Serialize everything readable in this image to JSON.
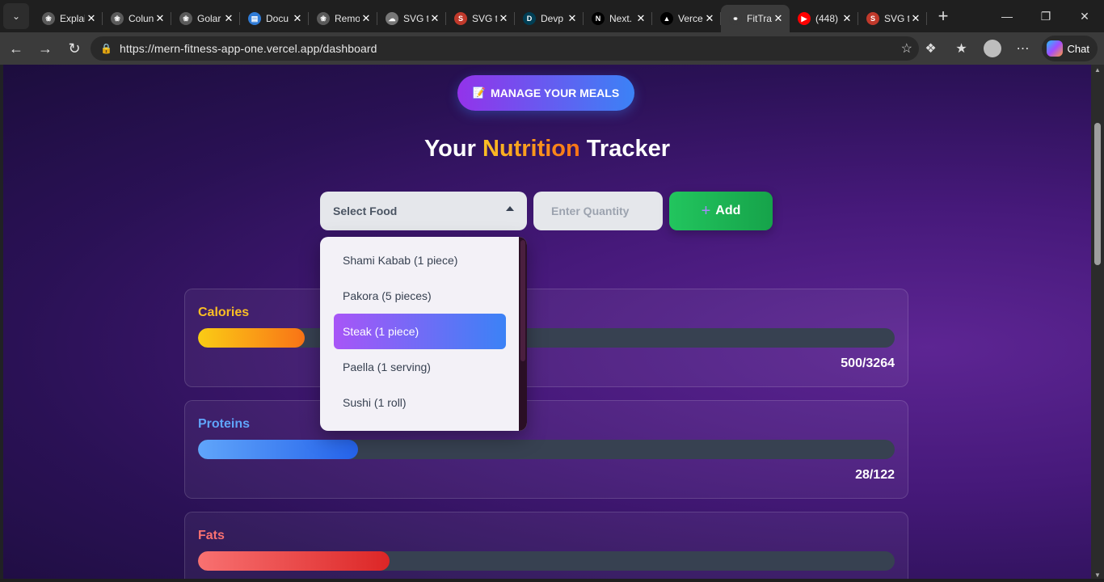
{
  "browser": {
    "tabs": [
      {
        "label": "Explai",
        "icon": "chatgpt-icon",
        "icon_color": "#5a5a5a",
        "active": false
      },
      {
        "label": "Colun",
        "icon": "chatgpt-icon",
        "icon_color": "#5a5a5a",
        "active": false
      },
      {
        "label": "Golar",
        "icon": "chatgpt-icon",
        "icon_color": "#5a5a5a",
        "active": false
      },
      {
        "label": "Docu",
        "icon": "doc-icon",
        "icon_color": "#2f7bd6",
        "active": false
      },
      {
        "label": "Remo",
        "icon": "chatgpt-icon",
        "icon_color": "#5a5a5a",
        "active": false
      },
      {
        "label": "SVG t",
        "icon": "cloud-icon",
        "icon_color": "#777777",
        "active": false
      },
      {
        "label": "SVG t",
        "icon": "svg-jpg-icon",
        "icon_color": "#c0392b",
        "active": false
      },
      {
        "label": "Devp",
        "icon": "devpost-icon",
        "icon_color": "#003e54",
        "active": false
      },
      {
        "label": "Next.",
        "icon": "nextjs-icon",
        "icon_color": "#000000",
        "active": false
      },
      {
        "label": "Verce",
        "icon": "vercel-icon",
        "icon_color": "#000000",
        "active": false
      },
      {
        "label": "FitTra",
        "icon": "link-icon",
        "icon_color": "#3b3b3b",
        "active": true
      },
      {
        "label": "(448)",
        "icon": "youtube-icon",
        "icon_color": "#ff0000",
        "active": false
      },
      {
        "label": "SVG t",
        "icon": "svg-png-icon",
        "icon_color": "#c0392b",
        "active": false
      }
    ],
    "url": "https://mern-fitness-app-one.vercel.app/dashboard",
    "chat_label": "Chat"
  },
  "page": {
    "manage_button": "MANAGE YOUR MEALS",
    "title_part1": "Your ",
    "title_highlight": "Nutrition",
    "title_part2": " Tracker",
    "select_placeholder": "Select Food",
    "quantity_placeholder": "Enter Quantity",
    "add_button": "Add",
    "dropdown_options": [
      {
        "label": "Shami Kabab (1 piece)",
        "selected": false
      },
      {
        "label": "Pakora (5 pieces)",
        "selected": false
      },
      {
        "label": "Steak (1 piece)",
        "selected": true
      },
      {
        "label": "Paella (1 serving)",
        "selected": false
      },
      {
        "label": "Sushi (1 roll)",
        "selected": false
      }
    ],
    "nutrients": [
      {
        "label": "Calories",
        "value": "500/3264",
        "progress": 0.153,
        "label_color": "#fbbf24",
        "gradient": [
          "#facc15",
          "#f97316"
        ]
      },
      {
        "label": "Proteins",
        "value": "28/122",
        "progress": 0.23,
        "label_color": "#60a5fa",
        "gradient": [
          "#60a5fa",
          "#2563eb"
        ]
      },
      {
        "label": "Fats",
        "value": "",
        "progress": 0.275,
        "label_color": "#f87171",
        "gradient": [
          "#f87171",
          "#dc2626"
        ]
      }
    ]
  }
}
